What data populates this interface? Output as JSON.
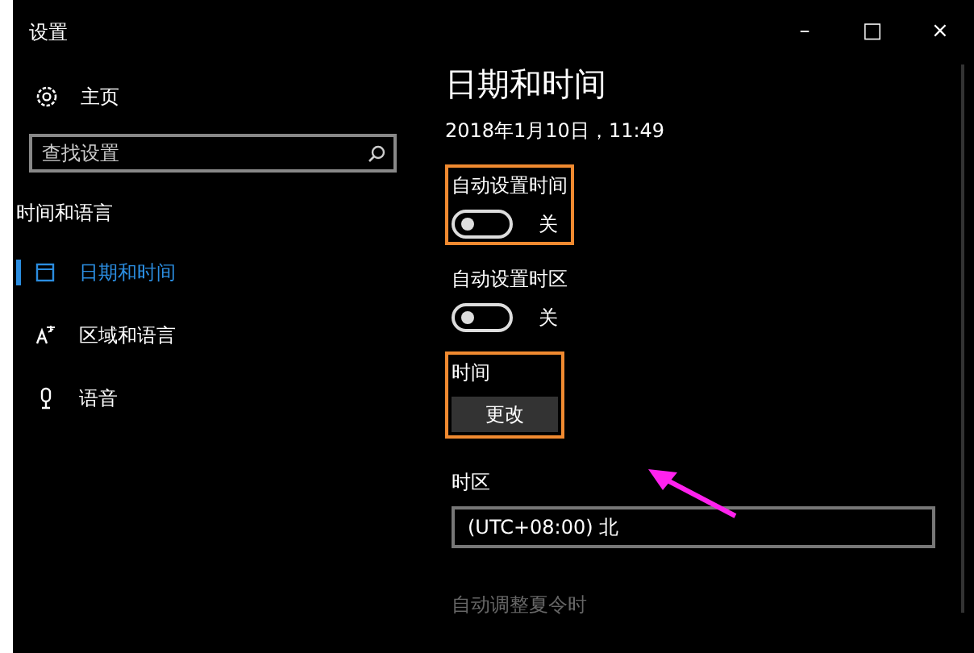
{
  "window": {
    "title": "设置",
    "controls": [
      "–",
      "□",
      "×"
    ]
  },
  "sidebar": {
    "home": "主页",
    "search": {
      "placeholder": "查找设置"
    },
    "section": "时间和语言",
    "items": [
      {
        "label": "日期和时间",
        "selected": true
      },
      {
        "label": "区域和语言",
        "selected": false
      },
      {
        "label": "语音",
        "selected": false
      }
    ]
  },
  "content": {
    "title": "日期和时间",
    "current": "2018年1月10日，11:49",
    "settings": [
      {
        "kind": "toggle",
        "label": "自动设置时间",
        "on": false,
        "state": "关",
        "highlighted": true,
        "disabled": false
      },
      {
        "kind": "toggle",
        "label": "自动设置时区",
        "on": false,
        "state": "关",
        "highlighted": false,
        "disabled": false
      },
      {
        "kind": "button",
        "label": "时间",
        "button": "更改",
        "highlighted": true,
        "disabled": false
      },
      {
        "kind": "select",
        "label": "时区",
        "value": "(UTC+08:00) 北",
        "highlighted": false,
        "disabled": false
      },
      {
        "kind": "heading",
        "label": "自动调整夏令时",
        "highlighted": false,
        "disabled": true
      }
    ]
  }
}
